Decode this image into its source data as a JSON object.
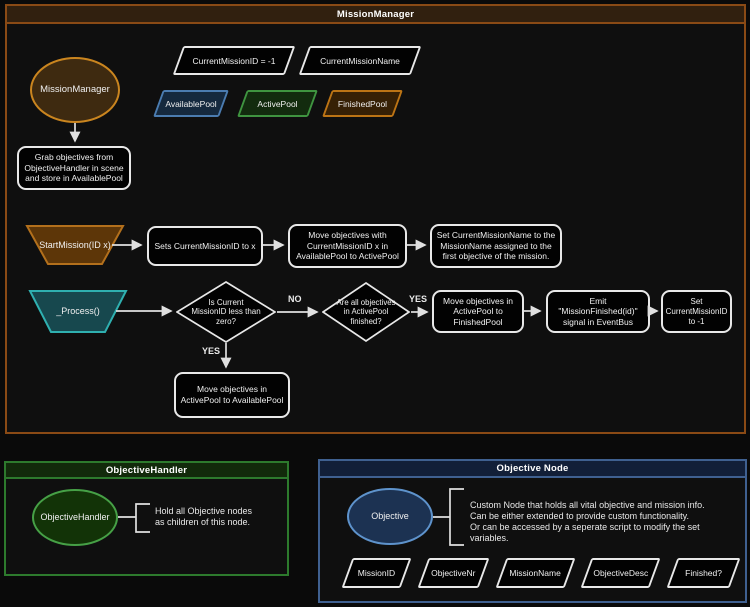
{
  "mission_manager": {
    "title": "MissionManager",
    "ellipse_label": "MissionManager",
    "var_id": "CurrentMissionID = -1",
    "var_name": "CurrentMissionName",
    "pools": [
      {
        "label": "AvailablePool",
        "stroke": "#4b7cb0",
        "fill": "#15293e"
      },
      {
        "label": "ActivePool",
        "stroke": "#3f9440",
        "fill": "#122b0e"
      },
      {
        "label": "FinishedPool",
        "stroke": "#bc7415",
        "fill": "#362005"
      }
    ],
    "grab_step": "Grab objectives from ObjectiveHandler in scene and store in AvailablePool",
    "start_mission": {
      "trigger": "StartMission(ID x)",
      "step1": "Sets CurrentMissionID to x",
      "step2": "Move objectives with CurrentMissionID x in AvailablePool to ActivePool",
      "step3": "Set CurrentMissionName to the MissionName assigned to the first objective of the mission."
    },
    "process": {
      "trigger": "_Process()",
      "decision1": "Is Current MissionID less than zero?",
      "label_no": "NO",
      "decision2": "Are all objectives in ActivePool finished?",
      "label_yes": "YES",
      "label_yes_down": "YES",
      "step_move_finished": "Move objectives in ActivePool to FinishedPool",
      "step_emit": "Emit \"MissionFinished(id)\" signal in EventBus",
      "step_reset": "Set CurrentMissionID to -1",
      "yes_branch": "Move objectives in ActivePool to AvailablePool"
    }
  },
  "objective_handler": {
    "title": "ObjectiveHandler",
    "ellipse_label": "ObjectiveHandler",
    "note": "Hold all Objective nodes as children of this node."
  },
  "objective_node": {
    "title": "Objective Node",
    "ellipse_label": "Objective",
    "note_lines": [
      "Custom Node that holds all vital objective and mission info.",
      "Can be either extended to provide custom functionality.",
      "Or can be accessed by a seperate script to modify the set variables."
    ],
    "fields": [
      "MissionID",
      "ObjectiveNr",
      "MissionName",
      "ObjectiveDesc",
      "Finished?"
    ]
  },
  "colors": {
    "accent_orange": "#8a4a15",
    "accent_green": "#2d7a2d",
    "accent_blue": "#3f6090",
    "arrow": "#e0e0e0"
  }
}
